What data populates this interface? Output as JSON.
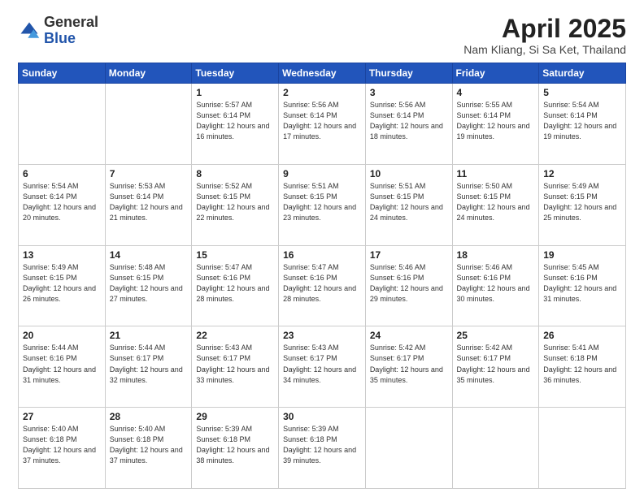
{
  "header": {
    "logo_general": "General",
    "logo_blue": "Blue",
    "title": "April 2025",
    "location": "Nam Kliang, Si Sa Ket, Thailand"
  },
  "weekdays": [
    "Sunday",
    "Monday",
    "Tuesday",
    "Wednesday",
    "Thursday",
    "Friday",
    "Saturday"
  ],
  "weeks": [
    [
      {
        "day": "",
        "detail": ""
      },
      {
        "day": "",
        "detail": ""
      },
      {
        "day": "1",
        "detail": "Sunrise: 5:57 AM\nSunset: 6:14 PM\nDaylight: 12 hours and 16 minutes."
      },
      {
        "day": "2",
        "detail": "Sunrise: 5:56 AM\nSunset: 6:14 PM\nDaylight: 12 hours and 17 minutes."
      },
      {
        "day": "3",
        "detail": "Sunrise: 5:56 AM\nSunset: 6:14 PM\nDaylight: 12 hours and 18 minutes."
      },
      {
        "day": "4",
        "detail": "Sunrise: 5:55 AM\nSunset: 6:14 PM\nDaylight: 12 hours and 19 minutes."
      },
      {
        "day": "5",
        "detail": "Sunrise: 5:54 AM\nSunset: 6:14 PM\nDaylight: 12 hours and 19 minutes."
      }
    ],
    [
      {
        "day": "6",
        "detail": "Sunrise: 5:54 AM\nSunset: 6:14 PM\nDaylight: 12 hours and 20 minutes."
      },
      {
        "day": "7",
        "detail": "Sunrise: 5:53 AM\nSunset: 6:14 PM\nDaylight: 12 hours and 21 minutes."
      },
      {
        "day": "8",
        "detail": "Sunrise: 5:52 AM\nSunset: 6:15 PM\nDaylight: 12 hours and 22 minutes."
      },
      {
        "day": "9",
        "detail": "Sunrise: 5:51 AM\nSunset: 6:15 PM\nDaylight: 12 hours and 23 minutes."
      },
      {
        "day": "10",
        "detail": "Sunrise: 5:51 AM\nSunset: 6:15 PM\nDaylight: 12 hours and 24 minutes."
      },
      {
        "day": "11",
        "detail": "Sunrise: 5:50 AM\nSunset: 6:15 PM\nDaylight: 12 hours and 24 minutes."
      },
      {
        "day": "12",
        "detail": "Sunrise: 5:49 AM\nSunset: 6:15 PM\nDaylight: 12 hours and 25 minutes."
      }
    ],
    [
      {
        "day": "13",
        "detail": "Sunrise: 5:49 AM\nSunset: 6:15 PM\nDaylight: 12 hours and 26 minutes."
      },
      {
        "day": "14",
        "detail": "Sunrise: 5:48 AM\nSunset: 6:15 PM\nDaylight: 12 hours and 27 minutes."
      },
      {
        "day": "15",
        "detail": "Sunrise: 5:47 AM\nSunset: 6:16 PM\nDaylight: 12 hours and 28 minutes."
      },
      {
        "day": "16",
        "detail": "Sunrise: 5:47 AM\nSunset: 6:16 PM\nDaylight: 12 hours and 28 minutes."
      },
      {
        "day": "17",
        "detail": "Sunrise: 5:46 AM\nSunset: 6:16 PM\nDaylight: 12 hours and 29 minutes."
      },
      {
        "day": "18",
        "detail": "Sunrise: 5:46 AM\nSunset: 6:16 PM\nDaylight: 12 hours and 30 minutes."
      },
      {
        "day": "19",
        "detail": "Sunrise: 5:45 AM\nSunset: 6:16 PM\nDaylight: 12 hours and 31 minutes."
      }
    ],
    [
      {
        "day": "20",
        "detail": "Sunrise: 5:44 AM\nSunset: 6:16 PM\nDaylight: 12 hours and 31 minutes."
      },
      {
        "day": "21",
        "detail": "Sunrise: 5:44 AM\nSunset: 6:17 PM\nDaylight: 12 hours and 32 minutes."
      },
      {
        "day": "22",
        "detail": "Sunrise: 5:43 AM\nSunset: 6:17 PM\nDaylight: 12 hours and 33 minutes."
      },
      {
        "day": "23",
        "detail": "Sunrise: 5:43 AM\nSunset: 6:17 PM\nDaylight: 12 hours and 34 minutes."
      },
      {
        "day": "24",
        "detail": "Sunrise: 5:42 AM\nSunset: 6:17 PM\nDaylight: 12 hours and 35 minutes."
      },
      {
        "day": "25",
        "detail": "Sunrise: 5:42 AM\nSunset: 6:17 PM\nDaylight: 12 hours and 35 minutes."
      },
      {
        "day": "26",
        "detail": "Sunrise: 5:41 AM\nSunset: 6:18 PM\nDaylight: 12 hours and 36 minutes."
      }
    ],
    [
      {
        "day": "27",
        "detail": "Sunrise: 5:40 AM\nSunset: 6:18 PM\nDaylight: 12 hours and 37 minutes."
      },
      {
        "day": "28",
        "detail": "Sunrise: 5:40 AM\nSunset: 6:18 PM\nDaylight: 12 hours and 37 minutes."
      },
      {
        "day": "29",
        "detail": "Sunrise: 5:39 AM\nSunset: 6:18 PM\nDaylight: 12 hours and 38 minutes."
      },
      {
        "day": "30",
        "detail": "Sunrise: 5:39 AM\nSunset: 6:18 PM\nDaylight: 12 hours and 39 minutes."
      },
      {
        "day": "",
        "detail": ""
      },
      {
        "day": "",
        "detail": ""
      },
      {
        "day": "",
        "detail": ""
      }
    ]
  ]
}
